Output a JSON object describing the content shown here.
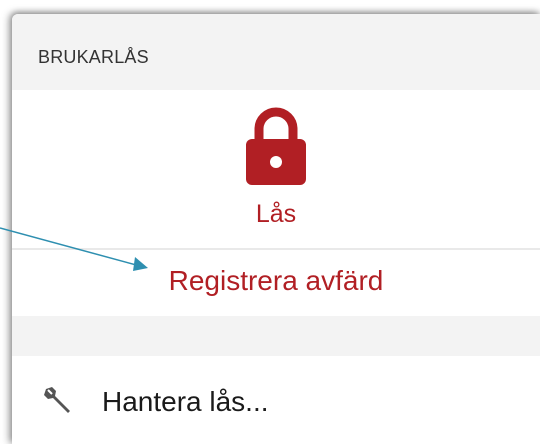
{
  "section": {
    "title": "BRUKARLÅS"
  },
  "lock": {
    "label": "Lås",
    "icon": "lock-icon"
  },
  "actions": {
    "register_departure": "Registrera avfärd"
  },
  "menu": {
    "manage_label": "Hantera lås...",
    "manage_icon": "wrench-icon"
  },
  "colors": {
    "accent": "#b11f24",
    "callout": "#2e8fb0"
  }
}
